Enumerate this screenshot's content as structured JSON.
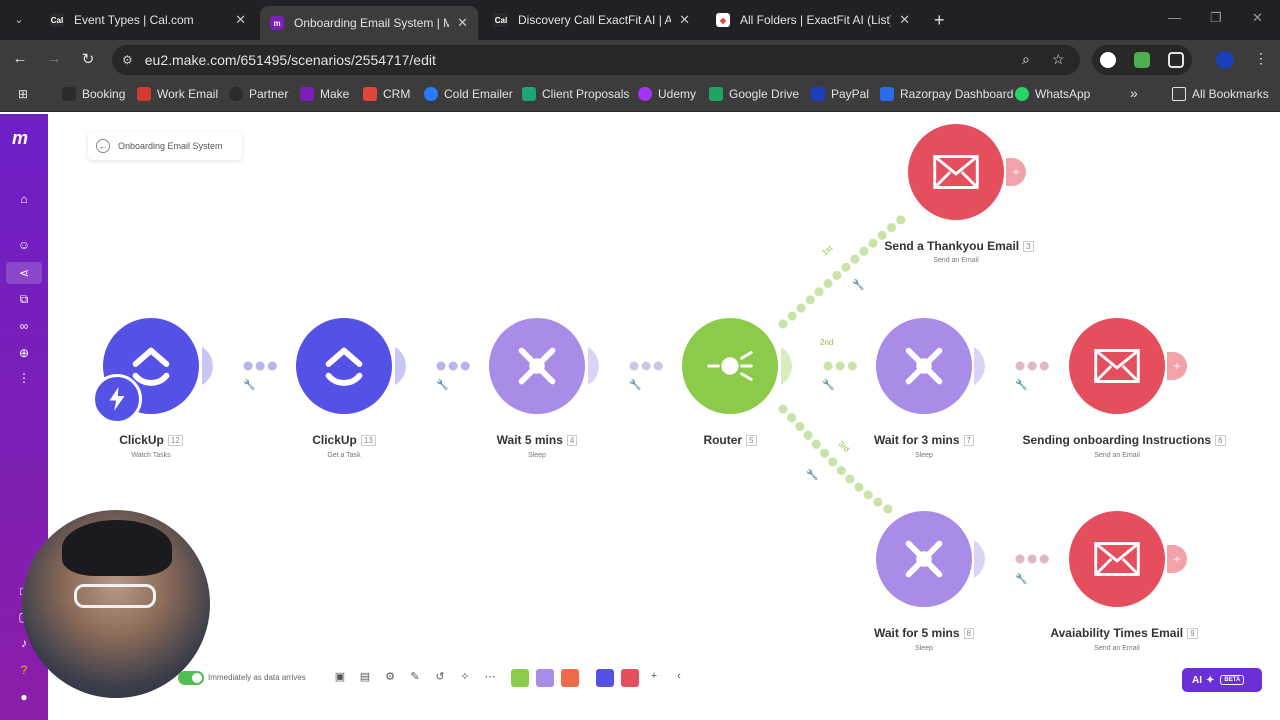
{
  "browser": {
    "tabs": [
      {
        "title": "Event Types | Cal.com",
        "icon": "calcom-icon",
        "active": false
      },
      {
        "title": "Onboarding Email System | Mal",
        "icon": "make-icon",
        "active": true
      },
      {
        "title": "Discovery Call ExactFit AI | Aksh",
        "icon": "calcom-icon",
        "active": false
      },
      {
        "title": "All Folders | ExactFit AI (List)",
        "icon": "clickup-icon",
        "active": false
      }
    ],
    "url": "eu2.make.com/651495/scenarios/2554717/edit",
    "bookmarks": [
      {
        "label": "Booking",
        "color": "#2b2b2b"
      },
      {
        "label": "Work Email",
        "color": "#d33a2f"
      },
      {
        "label": "Partner",
        "color": "#2b2b2b"
      },
      {
        "label": "Make",
        "color": "#7a1fb8"
      },
      {
        "label": "CRM",
        "color": "#e2463a"
      },
      {
        "label": "Cold Emailer",
        "color": "#2a7bff"
      },
      {
        "label": "Client Proposals",
        "color": "#1fa37a"
      },
      {
        "label": "Udemy",
        "color": "#a435f0"
      },
      {
        "label": "Google Drive",
        "color": "#1fa463"
      },
      {
        "label": "PayPal",
        "color": "#1a3fb8"
      },
      {
        "label": "Razorpay Dashboard",
        "color": "#2a6bf0"
      },
      {
        "label": "WhatsApp",
        "color": "#25d366"
      }
    ],
    "more_bookmarks": "»",
    "all_bookmarks": "All Bookmarks"
  },
  "scenario": {
    "back_label": "Onboarding Email System",
    "nodes": [
      {
        "id": "clickup-watch",
        "title": "ClickUp",
        "num": "12",
        "sub": "Watch Tasks",
        "color": "#5551e6"
      },
      {
        "id": "clickup-get",
        "title": "ClickUp",
        "num": "13",
        "sub": "Get a Task",
        "color": "#5551e6"
      },
      {
        "id": "wait-5",
        "title": "Wait 5 mins",
        "num": "4",
        "sub": "Sleep",
        "color": "#a98be8"
      },
      {
        "id": "router",
        "title": "Router",
        "num": "5",
        "sub": "",
        "color": "#8cca4a"
      },
      {
        "id": "thankyou",
        "title": "Send a Thankyou Email",
        "num": "3",
        "sub": "Send an Email",
        "color": "#e54e5c"
      },
      {
        "id": "wait-3",
        "title": "Wait for 3 mins",
        "num": "7",
        "sub": "Sleep",
        "color": "#a98be8"
      },
      {
        "id": "onboarding",
        "title": "Sending onboarding Instructions",
        "num": "6",
        "sub": "Send an Email",
        "color": "#e54e5c"
      },
      {
        "id": "wait-5b",
        "title": "Wait for 5 mins",
        "num": "8",
        "sub": "Sleep",
        "color": "#a98be8"
      },
      {
        "id": "availability",
        "title": "Avaiability Times Email",
        "num": "9",
        "sub": "Send an Email",
        "color": "#e54e5c"
      }
    ],
    "routes": [
      "1st",
      "2nd",
      "3rd"
    ]
  },
  "toolbar": {
    "schedule_label": "Immediately as data arrives"
  },
  "ai": {
    "label": "AI",
    "badge": "BETA"
  }
}
